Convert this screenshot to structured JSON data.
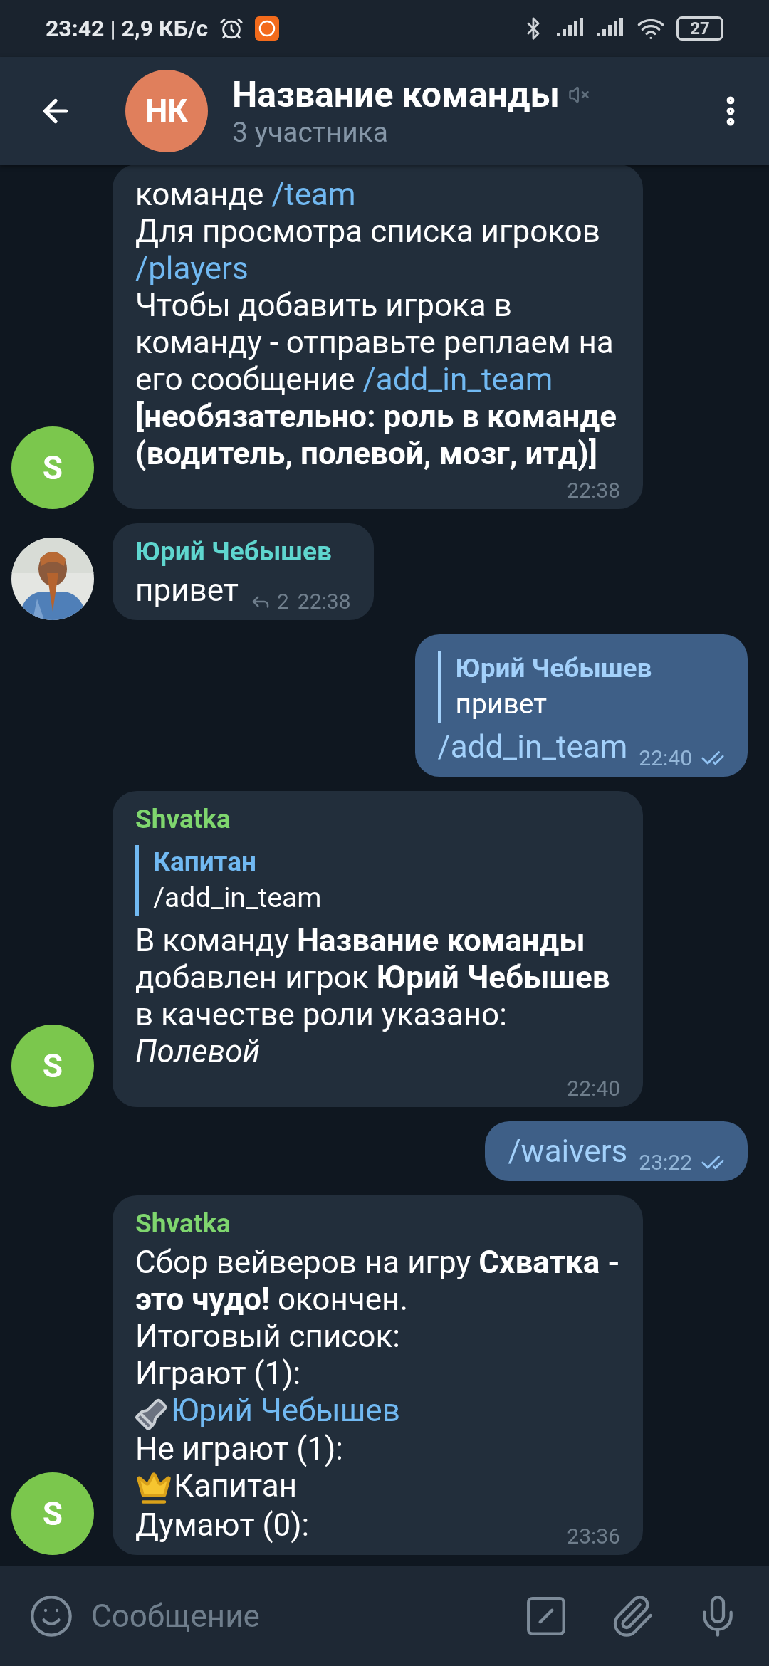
{
  "status_bar": {
    "text": "23:42 | 2,9 КБ/с",
    "battery": "27"
  },
  "header": {
    "avatar_initials": "НК",
    "title": "Название команды",
    "muted": true,
    "subtitle": "3 участника"
  },
  "messages": [
    {
      "kind": "incoming",
      "avatar": {
        "kind": "letter",
        "letter": "S",
        "color": "#7bc74d"
      },
      "paragraphs": [
        [
          {
            "kind": "text",
            "text": "команде "
          },
          {
            "kind": "link",
            "text": "/team"
          }
        ],
        [
          {
            "kind": "text",
            "text": "Для просмотра списка игроков "
          },
          {
            "kind": "link",
            "text": "/players"
          }
        ],
        [
          {
            "kind": "text",
            "text": "Чтобы добавить игрока в команду - отправьте реплаем на его сообщение "
          },
          {
            "kind": "link",
            "text": "/add_in_team"
          },
          {
            "kind": "text",
            "text": " **[необязательно: роль в команде (водитель, полевой, мозг, итд)]**"
          }
        ]
      ],
      "time": "22:38"
    },
    {
      "kind": "incoming",
      "avatar": {
        "kind": "picture"
      },
      "sender": "Юрий Чебышев",
      "color": "#5fd6cf",
      "paragraphs": [
        [
          {
            "kind": "text",
            "text": "привет"
          }
        ]
      ],
      "reply_count": "2",
      "time": "22:38"
    },
    {
      "kind": "outgoing",
      "quote": {
        "name": "Юрий Чебышев",
        "text": "привет"
      },
      "paragraphs": [
        [
          {
            "kind": "link",
            "text": "/add_in_team"
          }
        ]
      ],
      "time": "22:40",
      "read": true
    },
    {
      "kind": "incoming",
      "avatar": {
        "kind": "letter",
        "letter": "S",
        "color": "#7bc74d"
      },
      "sender": "Shvatka",
      "color": "#7fd66e",
      "quote": {
        "name": "Капитан",
        "text": "/add_in_team"
      },
      "paragraphs": [
        [
          {
            "kind": "text",
            "text": "В команду **Название команды** добавлен игрок **Юрий Чебышев** в качестве роли указано: *Полевой*"
          }
        ]
      ],
      "time": "22:40"
    },
    {
      "kind": "outgoing",
      "paragraphs": [
        [
          {
            "kind": "link",
            "text": "/waivers"
          }
        ]
      ],
      "time": "23:22",
      "read": true
    },
    {
      "kind": "incoming",
      "avatar": {
        "kind": "letter",
        "letter": "S",
        "color": "#7bc74d"
      },
      "sender": "Shvatka",
      "color": "#7fd66e",
      "paragraphs": [
        [
          {
            "kind": "text",
            "text": "Сбор вейверов на игру **Схватка - это чудо!** окончен."
          }
        ],
        [
          {
            "kind": "text",
            "text": "Итоговый список:"
          }
        ],
        [
          {
            "kind": "text",
            "text": "Играют (1):"
          }
        ],
        [
          {
            "kind": "flashlight"
          },
          {
            "kind": "link",
            "text": "Юрий Чебышев"
          }
        ],
        [
          {
            "kind": "text",
            "text": "Не играют (1):"
          }
        ],
        [
          {
            "kind": "crown"
          },
          {
            "kind": "text",
            "text": "Капитан"
          }
        ],
        [
          {
            "kind": "text",
            "text": "Думают (0):"
          }
        ]
      ],
      "time": "23:36"
    }
  ],
  "composer": {
    "placeholder": "Сообщение"
  }
}
